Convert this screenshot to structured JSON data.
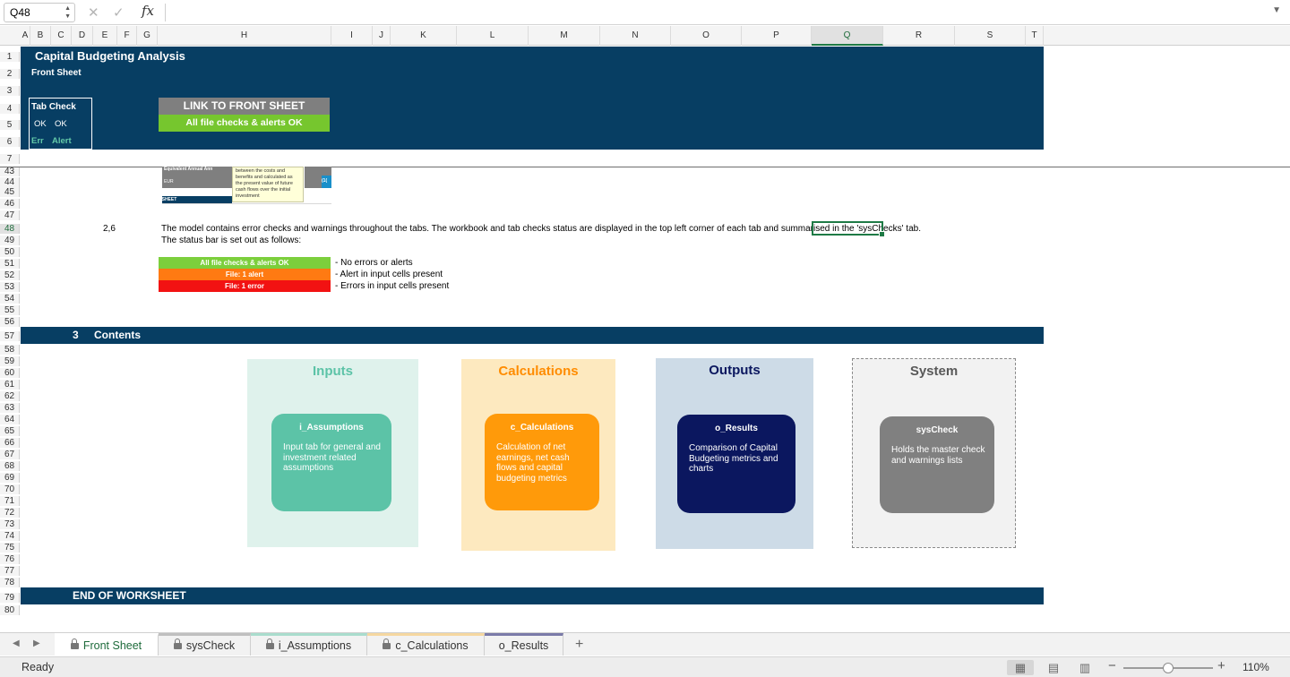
{
  "formula_bar": {
    "name_box": "Q48",
    "fx": "fx",
    "formula": ""
  },
  "columns": [
    "A",
    "B",
    "C",
    "D",
    "E",
    "F",
    "G",
    "H",
    "I",
    "J",
    "K",
    "L",
    "M",
    "N",
    "O",
    "P",
    "Q",
    "R",
    "S",
    "T"
  ],
  "selected_column": "Q",
  "rows": [
    "1",
    "2",
    "3",
    "4",
    "5",
    "6",
    "7",
    "43",
    "44",
    "45",
    "46",
    "47",
    "48",
    "49",
    "50",
    "51",
    "52",
    "53",
    "54",
    "55",
    "56",
    "57",
    "58",
    "59",
    "60",
    "61",
    "62",
    "63",
    "64",
    "65",
    "66",
    "67",
    "68",
    "69",
    "70",
    "71",
    "72",
    "73",
    "74",
    "75",
    "76",
    "77",
    "78",
    "79",
    "80"
  ],
  "selected_row": "48",
  "header": {
    "title": "Capital Budgeting Analysis",
    "subtitle": "Front Sheet",
    "tab_check": {
      "title": "Tab Check",
      "ok1": "OK",
      "ok2": "OK",
      "err": "Err",
      "alert": "Alert"
    },
    "link_button": "LINK TO FRONT SHEET",
    "status_button": "All file checks & alerts OK"
  },
  "thumbnail": {
    "label1": "Equivalent Annual Ann",
    "label2": "EUR",
    "label3": "KSHEET",
    "tooltip": "between the costs and benefits and calculated as the present value of future cash flows over the initial investment",
    "value": "(1("
  },
  "section_26": {
    "number": "2,6",
    "line1": "The model contains error checks and warnings throughout the tabs. The workbook and tab checks status are displayed in the top left corner of each tab and summarised in the 'sysChecks' tab.",
    "line2": "The status bar is set out as follows:",
    "legend": [
      {
        "label": "All file checks & alerts OK",
        "desc": "- No errors or alerts",
        "color": "#7ccf3c"
      },
      {
        "label": "File: 1 alert",
        "desc": "- Alert in input cells present",
        "color": "#ff7a12"
      },
      {
        "label": "File: 1 error",
        "desc": "- Errors in input cells present",
        "color": "#f21212"
      }
    ]
  },
  "contents": {
    "number": "3",
    "title": "Contents",
    "boxes": [
      {
        "title": "Inputs",
        "card_title": "i_Assumptions",
        "card_desc": "Input tab for general and investment related assumptions",
        "bg": "#dff2ec",
        "title_color": "#5cc3a7",
        "card_color": "#5cc3a7"
      },
      {
        "title": "Calculations",
        "card_title": "c_Calculations",
        "card_desc": "Calculation of net earnings, net cash flows and capital budgeting metrics",
        "bg": "#fde9bf",
        "title_color": "#ff8c00",
        "card_color": "#ff9a0a"
      },
      {
        "title": "Outputs",
        "card_title": "o_Results",
        "card_desc": "Comparison of Capital Budgeting metrics and charts",
        "bg": "#cddbe7",
        "title_color": "#0b175f",
        "card_color": "#0b175f"
      },
      {
        "title": "System",
        "card_title": "sysCheck",
        "card_desc": "Holds the master check and warnings lists",
        "bg": "#f2f2f2",
        "title_color": "#595959",
        "card_color": "#808080"
      }
    ]
  },
  "end_title": "END OF WORKSHEET",
  "sheet_tabs": [
    {
      "label": "Front Sheet",
      "locked": true,
      "active": true,
      "accent": "#ffffff"
    },
    {
      "label": "sysCheck",
      "locked": true,
      "active": false,
      "accent": "#bfbfbf"
    },
    {
      "label": "i_Assumptions",
      "locked": true,
      "active": false,
      "accent": "#a9dccd"
    },
    {
      "label": "c_Calculations",
      "locked": true,
      "active": false,
      "accent": "#f5d7a0"
    },
    {
      "label": "o_Results",
      "locked": false,
      "active": false,
      "accent": "#7a7aa8"
    }
  ],
  "add_sheet": "+",
  "status_bar": {
    "status": "Ready",
    "zoom": "110%",
    "zoom_fraction": 0.5
  }
}
